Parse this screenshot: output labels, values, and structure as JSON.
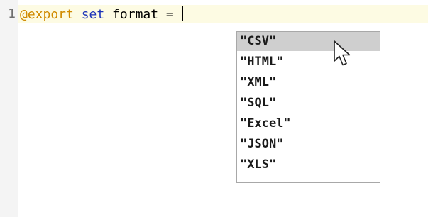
{
  "editor": {
    "line_number": "1",
    "tokens": {
      "annotation": "@export",
      "keyword": "set",
      "rest": " format = "
    }
  },
  "autocomplete": {
    "selected_index": 0,
    "options": [
      "\"CSV\"",
      "\"HTML\"",
      "\"XML\"",
      "\"SQL\"",
      "\"Excel\"",
      "\"JSON\"",
      "\"XLS\""
    ]
  },
  "cursor": {
    "icon": "mouse-pointer-icon"
  },
  "colors": {
    "annotation": "#d08a00",
    "keyword": "#1c33b9",
    "selected_item_bg": "#cfcfcf",
    "current_line_bg": "#fdfbe3"
  }
}
